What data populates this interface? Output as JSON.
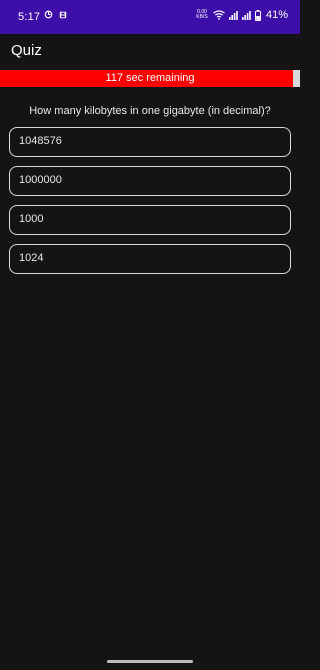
{
  "status_bar": {
    "time": "5:17",
    "net_speed_value": "0.00",
    "net_speed_unit": "KB/S",
    "battery": "41%",
    "icons": [
      "sync-icon",
      "storage-icon",
      "net-speed-indicator",
      "wifi-icon",
      "signal-icon",
      "signal-icon",
      "battery-icon"
    ],
    "color": "#3e0fa8"
  },
  "app_bar": {
    "title": "Quiz"
  },
  "timer": {
    "label": "117 sec remaining",
    "remaining_fraction": 0.975,
    "fill_color": "#ff0000"
  },
  "question": {
    "text": "How many kilobytes in one gigabyte (in decimal)?"
  },
  "answers": [
    {
      "label": "1048576"
    },
    {
      "label": "1000000"
    },
    {
      "label": "1000"
    },
    {
      "label": "1024"
    }
  ]
}
